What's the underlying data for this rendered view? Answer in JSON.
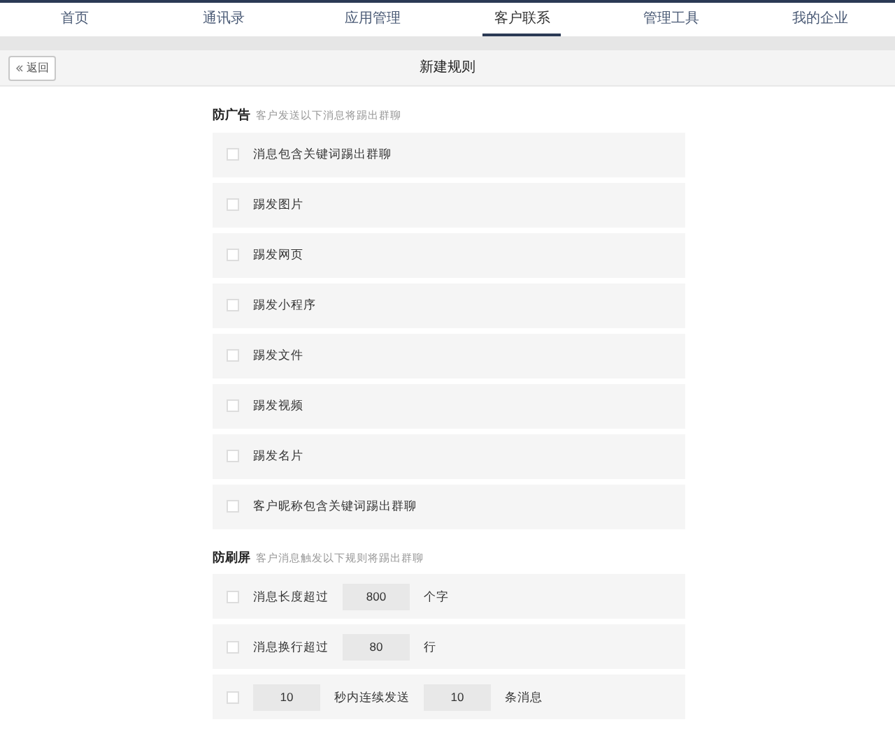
{
  "nav": [
    {
      "label": "首页",
      "selected": false
    },
    {
      "label": "通讯录",
      "selected": false
    },
    {
      "label": "应用管理",
      "selected": false
    },
    {
      "label": "客户联系",
      "selected": true
    },
    {
      "label": "管理工具",
      "selected": false
    },
    {
      "label": "我的企业",
      "selected": false
    }
  ],
  "header": {
    "back": "返回",
    "title": "新建规则"
  },
  "sections": [
    {
      "title": "防广告",
      "hint": "客户发送以下消息将踢出群聊",
      "rules": [
        {
          "checked": false,
          "parts": [
            {
              "kind": "text",
              "text": "消息包含关键词踢出群聊"
            }
          ]
        },
        {
          "checked": false,
          "parts": [
            {
              "kind": "text",
              "text": "踢发图片"
            }
          ]
        },
        {
          "checked": false,
          "parts": [
            {
              "kind": "text",
              "text": "踢发网页"
            }
          ]
        },
        {
          "checked": false,
          "parts": [
            {
              "kind": "text",
              "text": "踢发小程序"
            }
          ]
        },
        {
          "checked": false,
          "parts": [
            {
              "kind": "text",
              "text": "踢发文件"
            }
          ]
        },
        {
          "checked": false,
          "parts": [
            {
              "kind": "text",
              "text": "踢发视频"
            }
          ]
        },
        {
          "checked": false,
          "parts": [
            {
              "kind": "text",
              "text": "踢发名片"
            }
          ]
        },
        {
          "checked": false,
          "parts": [
            {
              "kind": "text",
              "text": "客户昵称包含关键词踢出群聊"
            }
          ]
        }
      ]
    },
    {
      "title": "防刷屏",
      "hint": "客户消息触发以下规则将踢出群聊",
      "rules": [
        {
          "checked": false,
          "parts": [
            {
              "kind": "text",
              "text": "消息长度超过"
            },
            {
              "kind": "input",
              "value": "800"
            },
            {
              "kind": "text",
              "text": "个字"
            }
          ]
        },
        {
          "checked": false,
          "parts": [
            {
              "kind": "text",
              "text": "消息换行超过"
            },
            {
              "kind": "input",
              "value": "80"
            },
            {
              "kind": "text",
              "text": "行"
            }
          ]
        },
        {
          "checked": false,
          "parts": [
            {
              "kind": "input",
              "value": "10"
            },
            {
              "kind": "text",
              "text": "秒内连续发送"
            },
            {
              "kind": "input",
              "value": "10"
            },
            {
              "kind": "text",
              "text": "条消息"
            }
          ]
        }
      ]
    }
  ]
}
